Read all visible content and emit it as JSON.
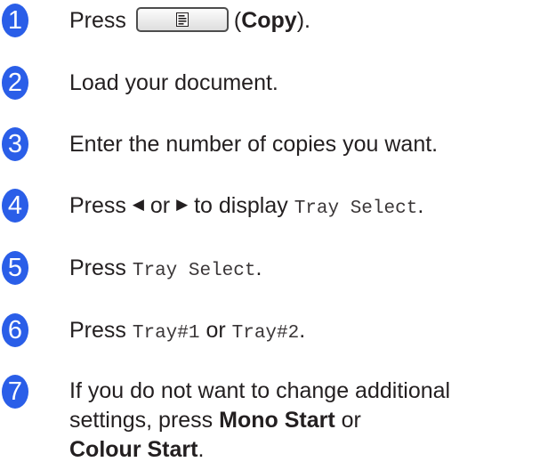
{
  "steps": [
    {
      "number": "1",
      "press": "Press",
      "copy_label": "Copy",
      "close_paren": ")."
    },
    {
      "number": "2",
      "text": "Load your document."
    },
    {
      "number": "3",
      "text": "Enter the number of copies you want."
    },
    {
      "number": "4",
      "press": "Press",
      "left_arrow": "◀",
      "or": "or",
      "right_arrow": "▶",
      "to_display": "to display",
      "code": "Tray Select",
      "period": "."
    },
    {
      "number": "5",
      "press": "Press",
      "code": "Tray Select",
      "period": "."
    },
    {
      "number": "6",
      "press": "Press",
      "code_a": "Tray#1",
      "or": "or",
      "code_b": "Tray#2",
      "period": "."
    },
    {
      "number": "7",
      "line1": "If you do not want to change additional",
      "line2_pre": "settings, press",
      "mono_start": "Mono Start",
      "or": "or",
      "colour_start": "Colour Start",
      "period": "."
    }
  ],
  "icons": {
    "copy_key": "copy-document-icon"
  },
  "colors": {
    "badge": "#2a5ee8",
    "text": "#231f20"
  }
}
